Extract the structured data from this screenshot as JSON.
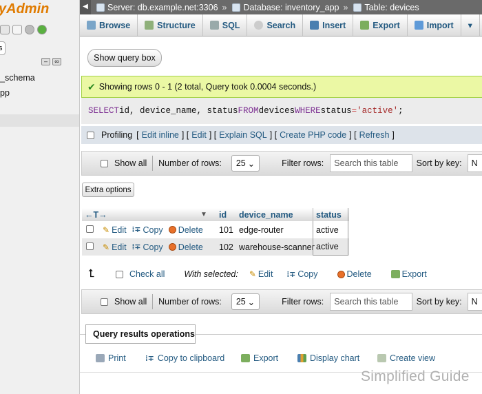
{
  "nav_panel": {
    "logo": "yAdmin",
    "collapse_label": "s",
    "db_items": [
      "_schema",
      "pp"
    ]
  },
  "breadcrumb": {
    "server": "Server: db.example.net:3306",
    "database": "Database: inventory_app",
    "table": "Table: devices",
    "separator": "»"
  },
  "tabs": [
    {
      "label": "Browse",
      "icon": "browse-icon"
    },
    {
      "label": "Structure",
      "icon": "structure-icon"
    },
    {
      "label": "SQL",
      "icon": "sql-icon"
    },
    {
      "label": "Search",
      "icon": "search-icon"
    },
    {
      "label": "Insert",
      "icon": "insert-icon"
    },
    {
      "label": "Export",
      "icon": "export-icon"
    },
    {
      "label": "Import",
      "icon": "import-icon"
    },
    {
      "label": "▾",
      "icon": "more-icon"
    }
  ],
  "query_box": {
    "show_label": "Show query box"
  },
  "status": {
    "message": "Showing rows 0 - 1 (2 total, Query took 0.0004 seconds.)"
  },
  "sql": {
    "select": "SELECT",
    "cols": " id, device_name, status ",
    "from": "FROM",
    "table": " devices ",
    "where": "WHERE",
    "field": " status ",
    "op": "=",
    "value": " 'active'",
    "end": ";"
  },
  "profiling": {
    "label": "Profiling",
    "links": [
      "Edit inline",
      "Edit",
      "Explain SQL",
      "Create PHP code",
      "Refresh"
    ]
  },
  "nav_top": {
    "show_all": "Show all",
    "rows_label": "Number of rows:",
    "rows_value": "25",
    "filter_label": "Filter rows:",
    "filter_placeholder": "Search this table",
    "sort_label": "Sort by key:",
    "sort_value": "N"
  },
  "extra_options": "Extra options",
  "table": {
    "col_arrows": "←T→",
    "headers": [
      "id",
      "device_name",
      "status"
    ],
    "actions": {
      "edit": "Edit",
      "copy": "Copy",
      "delete": "Delete"
    },
    "rows": [
      {
        "id": "101",
        "device_name": "edge-router",
        "status": "active"
      },
      {
        "id": "102",
        "device_name": "warehouse-scanner",
        "status": "active"
      }
    ]
  },
  "with_selected": {
    "check_all": "Check all",
    "label": "With selected:",
    "edit": "Edit",
    "copy": "Copy",
    "delete": "Delete",
    "export": "Export"
  },
  "operations": {
    "title": "Query results operations",
    "print": "Print",
    "copy_clipboard": "Copy to clipboard",
    "export": "Export",
    "display_chart": "Display chart",
    "create_view": "Create view"
  },
  "watermark": "Simplified Guide",
  "colors": {
    "link": "#235a81",
    "success_bg": "#ebf8a4",
    "success_border": "#a2d246",
    "breadcrumb_bg": "#6a6a6a"
  }
}
